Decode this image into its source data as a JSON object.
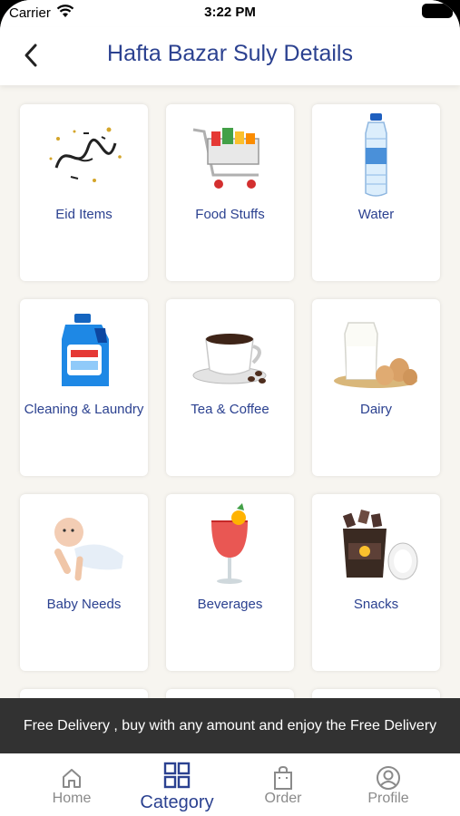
{
  "status": {
    "carrier": "Carrier",
    "time": "3:22 PM"
  },
  "header": {
    "title": "Hafta Bazar Suly Details"
  },
  "categories": [
    {
      "label": "Eid Items",
      "icon": "eid-mubarak-calligraphy-icon"
    },
    {
      "label": "Food Stuffs",
      "icon": "shopping-cart-icon"
    },
    {
      "label": "Water",
      "icon": "water-bottle-icon"
    },
    {
      "label": "Cleaning & Laundry",
      "icon": "detergent-bottle-icon"
    },
    {
      "label": "Tea & Coffee",
      "icon": "coffee-cup-icon"
    },
    {
      "label": "Dairy",
      "icon": "milk-eggs-icon"
    },
    {
      "label": "Baby Needs",
      "icon": "baby-icon"
    },
    {
      "label": "Beverages",
      "icon": "cocktail-glass-icon"
    },
    {
      "label": "Snacks",
      "icon": "chocolate-snacks-icon"
    }
  ],
  "banner": {
    "text": "Free Delivery , buy with any amount and enjoy the Free Delivery"
  },
  "tabs": [
    {
      "label": "Home",
      "icon": "home-icon",
      "active": false
    },
    {
      "label": "Category",
      "icon": "grid-icon",
      "active": true
    },
    {
      "label": "Order",
      "icon": "bag-icon",
      "active": false
    },
    {
      "label": "Profile",
      "icon": "user-circle-icon",
      "active": false
    }
  ],
  "colors": {
    "accent": "#2b4190",
    "banner_bg": "#323232",
    "inactive_tab": "#8a8a8a",
    "page_bg": "#f7f5f0"
  }
}
